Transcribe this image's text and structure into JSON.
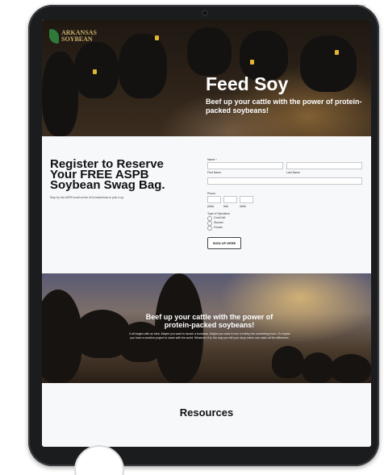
{
  "logo": {
    "line1": "ARKANSAS",
    "line2": "SOYBEAN"
  },
  "hero": {
    "title": "Feed Soy",
    "subtitle": "Beef up your cattle with the power of protein-packed soybeans!"
  },
  "register": {
    "title": "Register to Reserve Your FREE ASPB Soybean Swag Bag.",
    "note": "Stop by the ASPB booth at the ACA tradeshow to pick it up."
  },
  "form": {
    "name_label": "Name *",
    "first_name_label": "First Name",
    "last_name_label": "Last Name",
    "phone_label": "Phone",
    "phone_parts": [
      "(###)",
      "###",
      "####"
    ],
    "operation_label": "Type of Operation",
    "operation_options": [
      "Cow/Calf",
      "Stocker",
      "Feeder"
    ],
    "submit_label": "SIGN UP HERE"
  },
  "sunset": {
    "title": "Beef up your cattle with the power of protein-packed soybeans!",
    "text": "It all begins with an idea. Maybe you want to launch a business. Maybe you want to turn a hobby into something more. Or maybe you have a creative project to share with the world. Whatever it is, the way you tell your story online can make all the difference."
  },
  "resources": {
    "title": "Resources"
  },
  "colors": {
    "logo_green": "#2f7a3a",
    "ear_tag": "#e2b533",
    "tablet_frame": "#1b1c1e"
  }
}
